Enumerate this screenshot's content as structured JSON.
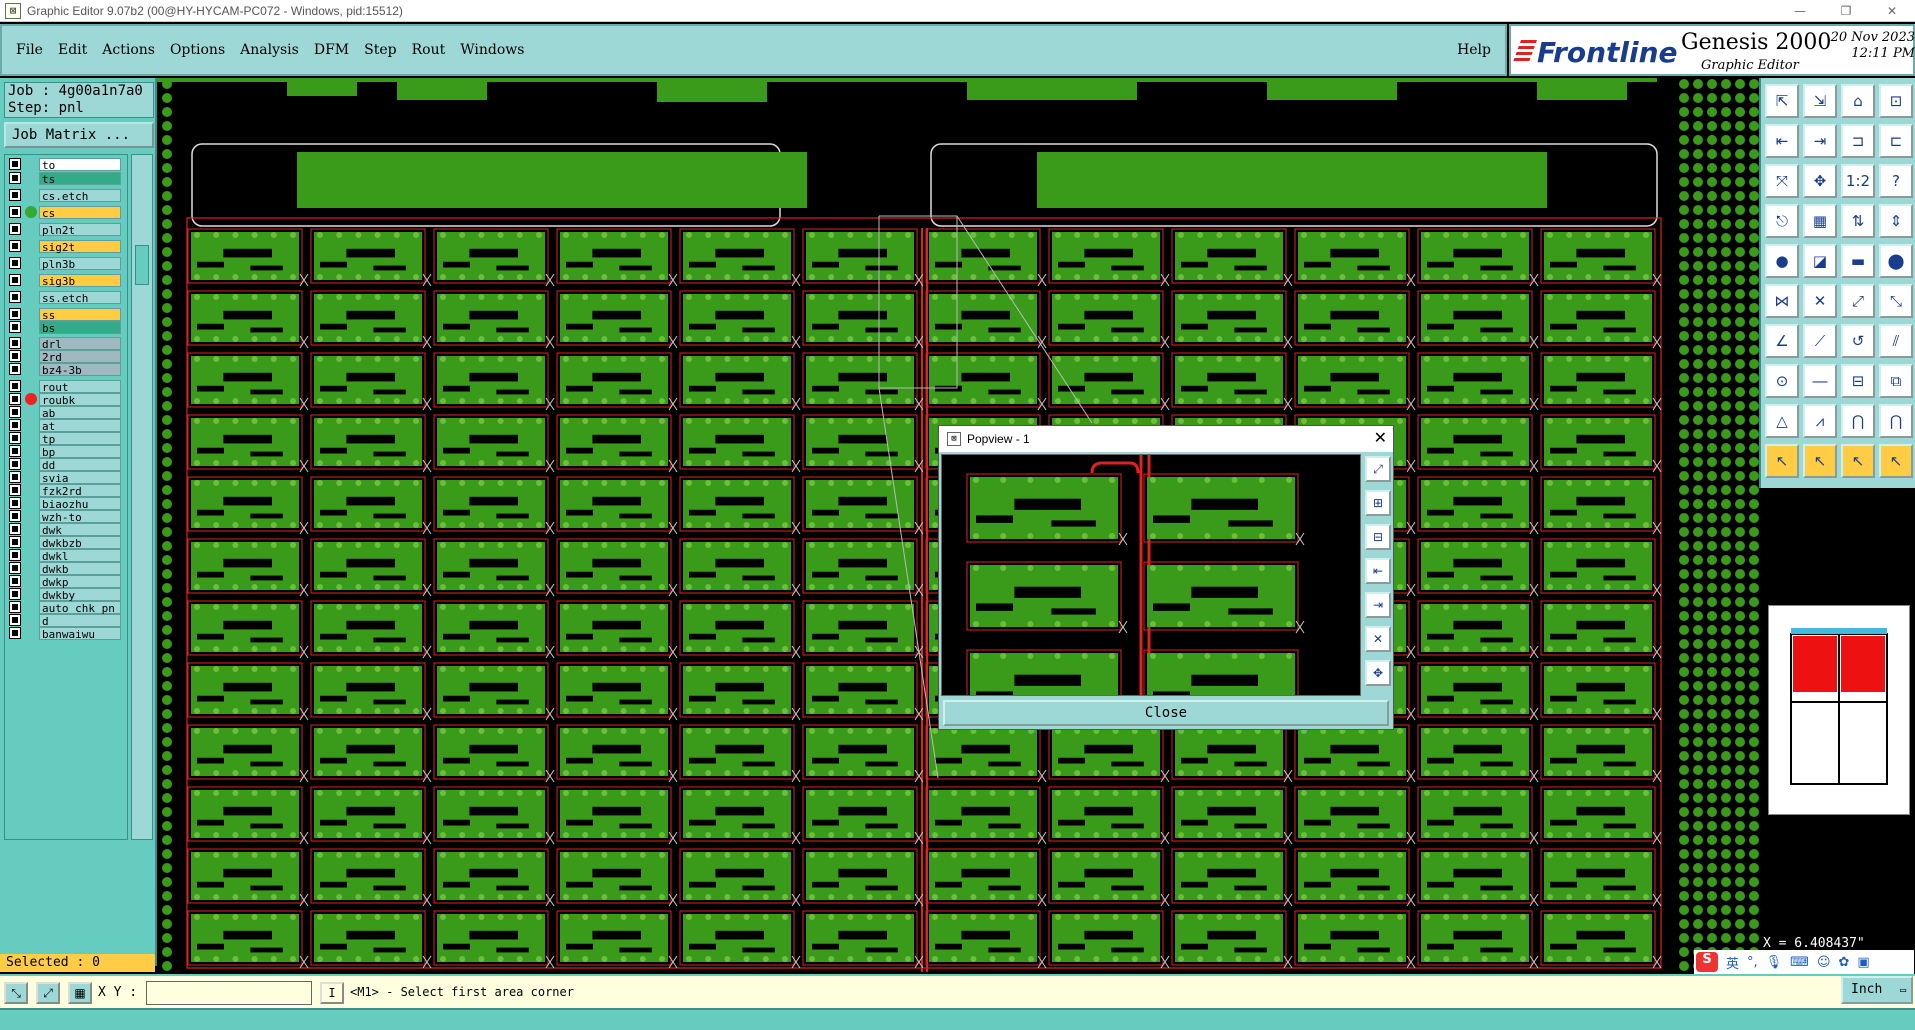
{
  "window": {
    "title": "Graphic Editor 9.07b2 (00@HY-HYCAM-PC072 - Windows, pid:15512)",
    "icon": "graphic-editor-icon"
  },
  "menu": {
    "items": [
      "File",
      "Edit",
      "Actions",
      "Options",
      "Analysis",
      "DFM",
      "Step",
      "Rout",
      "Windows"
    ],
    "help": "Help"
  },
  "brand": {
    "logo": "Frontline",
    "product": "Genesis 2000",
    "subtitle": "Graphic Editor",
    "date": "20 Nov 2023",
    "time": "12:11 PM"
  },
  "job": {
    "job_line": "Job : 4g00a1n7a0",
    "step_line": "Step: pnl",
    "matrix_button": "Job Matrix ..."
  },
  "layers": [
    {
      "name": "to",
      "style": "out",
      "dot": ""
    },
    {
      "name": "ts",
      "style": "red",
      "dot": ""
    },
    {
      "name": "cs.etch",
      "style": "",
      "dot": ""
    },
    {
      "name": "cs",
      "style": "yel",
      "dot": "#33aa33"
    },
    {
      "name": "pln2t",
      "style": "",
      "dot": ""
    },
    {
      "name": "sig2t",
      "style": "yel",
      "dot": ""
    },
    {
      "name": "pln3b",
      "style": "",
      "dot": ""
    },
    {
      "name": "sig3b",
      "style": "yel",
      "dot": ""
    },
    {
      "name": "ss.etch",
      "style": "",
      "dot": ""
    },
    {
      "name": "ss",
      "style": "yel",
      "dot": ""
    },
    {
      "name": "bs",
      "style": "red",
      "dot": ""
    },
    {
      "name": "drl",
      "style": "grey",
      "dot": ""
    },
    {
      "name": "2rd",
      "style": "grey",
      "dot": ""
    },
    {
      "name": "bz4-3b",
      "style": "grey",
      "dot": ""
    },
    {
      "name": "rout",
      "style": "",
      "dot": ""
    },
    {
      "name": "roubk",
      "style": "",
      "dot": "#ee2222"
    },
    {
      "name": "ab",
      "style": "",
      "dot": ""
    },
    {
      "name": "at",
      "style": "",
      "dot": ""
    },
    {
      "name": "tp",
      "style": "",
      "dot": ""
    },
    {
      "name": "bp",
      "style": "",
      "dot": ""
    },
    {
      "name": "dd",
      "style": "",
      "dot": ""
    },
    {
      "name": "svia",
      "style": "",
      "dot": ""
    },
    {
      "name": "fzk2rd",
      "style": "",
      "dot": ""
    },
    {
      "name": "biaozhu",
      "style": "",
      "dot": ""
    },
    {
      "name": "wzh-to",
      "style": "",
      "dot": ""
    },
    {
      "name": "dwk",
      "style": "",
      "dot": ""
    },
    {
      "name": "dwkbzb",
      "style": "",
      "dot": ""
    },
    {
      "name": "dwkl",
      "style": "",
      "dot": ""
    },
    {
      "name": "dwkb",
      "style": "",
      "dot": ""
    },
    {
      "name": "dwkp",
      "style": "",
      "dot": ""
    },
    {
      "name": "dwkby",
      "style": "",
      "dot": ""
    },
    {
      "name": "auto_chk_pn",
      "style": "",
      "dot": ""
    },
    {
      "name": "d",
      "style": "",
      "dot": ""
    },
    {
      "name": "banwaiwu",
      "style": "",
      "dot": ""
    }
  ],
  "selected": "Selected : 0",
  "popview": {
    "title": "Popview - 1",
    "close": "Close",
    "tools": [
      "zoom-fit-icon",
      "zoom-in-icon",
      "zoom-out-icon",
      "pan-left-icon",
      "pan-right-icon",
      "zoom-area-icon",
      "zoom-center-icon"
    ]
  },
  "tools": [
    "tool-1-icon",
    "tool-2-icon",
    "tool-3-icon",
    "tool-4-icon",
    "tool-5-icon",
    "tool-6-icon",
    "tool-7-icon",
    "tool-8-icon",
    "tool-9-icon",
    "tool-10-icon",
    "scale-1-2-icon",
    "help-question-icon",
    "tool-13-icon",
    "tool-14-icon",
    "tool-15-icon",
    "tool-16-icon",
    "tool-17-icon",
    "tool-18-icon",
    "tool-19-icon",
    "tool-20-icon",
    "tool-21-icon",
    "tool-22-icon",
    "tool-23-icon",
    "tool-24-icon",
    "tool-25-icon",
    "tool-26-icon",
    "tool-27-icon",
    "tool-28-icon",
    "tool-29-icon",
    "tool-30-icon",
    "tool-31-icon",
    "tool-32-icon",
    "tool-33-icon",
    "tool-34-icon",
    "tool-35-icon",
    "tool-36-icon",
    "pointer-icon",
    "pointer-select-icon",
    "pointer-edit-icon",
    "pointer-multi-icon"
  ],
  "coordinates": {
    "x_readout": "X = 6.408437\""
  },
  "status": {
    "xy_label": "X Y :",
    "xy_value": "",
    "prompt": "<M1> - Select first area corner",
    "units": "Inch"
  },
  "tray": {
    "ime_logo": "S",
    "ime_lang": "英"
  },
  "colors": {
    "panel": "#9ed8d6",
    "panel_dark": "#66ccc0",
    "pcb_green": "#3a9a1a",
    "route_red": "#dd2222",
    "selected_yellow": "#ffcc44"
  }
}
